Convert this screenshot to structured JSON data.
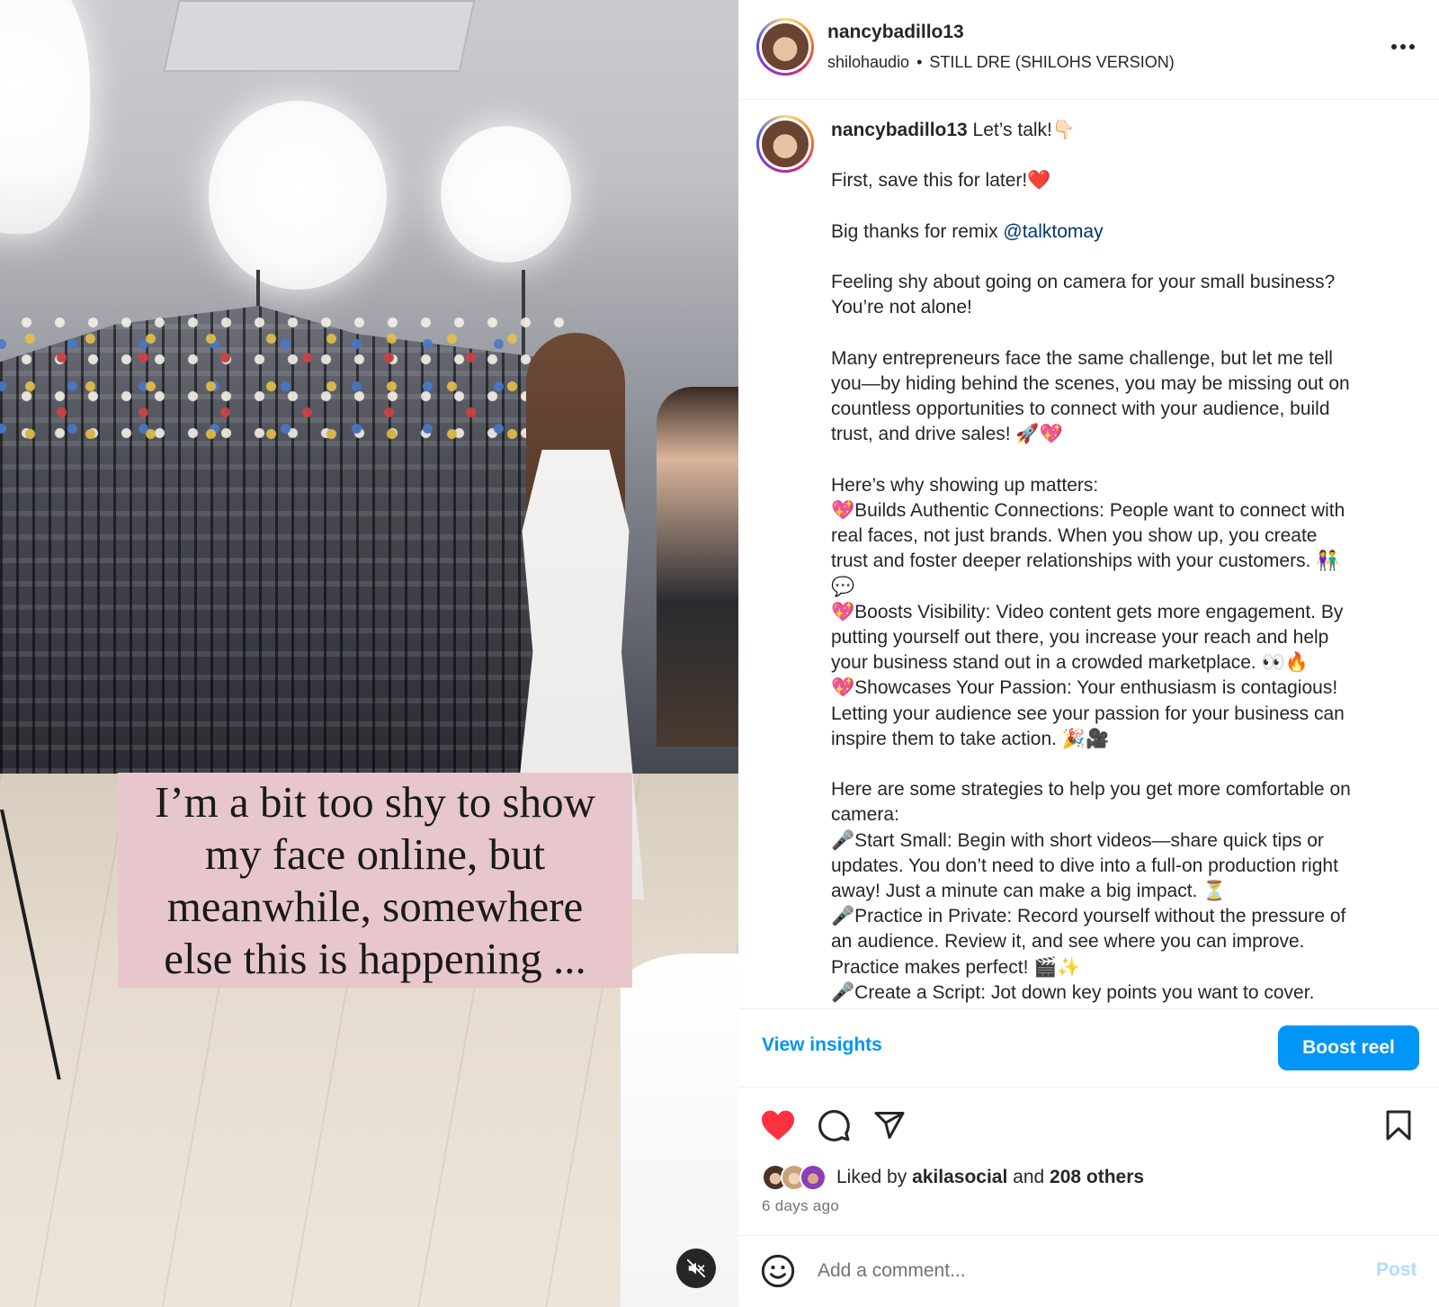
{
  "video": {
    "overlay_text": "I’m a bit too shy to show my face online, but meanwhile, somewhere else this is happening ...",
    "mute_icon": "speaker-muted-icon"
  },
  "header": {
    "username": "nancybadillo13",
    "audio_artist": "shilohaudio",
    "audio_separator": "•",
    "audio_track": "STILL DRE (SHILOHS VERSION)",
    "more_icon": "more-horizontal-icon"
  },
  "caption": {
    "username": "nancybadillo13",
    "opening": " Let’s talk!👇🏻",
    "save_line": "First, save this for later!❤️",
    "thanks_prefix": "Big thanks for remix ",
    "mention": "@talktomay",
    "shy_l1": "Feeling shy about going on camera for your small business?",
    "shy_l2": "You’re not alone!",
    "many_l1": "Many entrepreneurs face the same challenge, but let me tell",
    "many_l2": "you—by hiding behind the scenes, you may be missing out on",
    "many_l3": "countless opportunities to connect with your audience, build",
    "many_l4": "trust, and drive sales! 🚀💖",
    "why_heading": "Here’s why showing up matters:",
    "why_1_l1": "💖Builds Authentic Connections: People want to connect with",
    "why_1_l2": "real faces, not just brands. When you show up, you create",
    "why_1_l3": "trust and foster deeper relationships with your customers. 👫",
    "why_1_l4": "💬",
    "why_2_l1": "💖Boosts Visibility: Video content gets more engagement. By",
    "why_2_l2": "putting yourself out there, you increase your reach and help",
    "why_2_l3": "your business stand out in a crowded marketplace. 👀🔥",
    "why_3_l1": "💖Showcases Your Passion: Your enthusiasm is contagious!",
    "why_3_l2": "Letting your audience see your passion for your business can",
    "why_3_l3": "inspire them to take action. 🎉🎥",
    "strat_l1": "Here are some strategies to help you get more comfortable on",
    "strat_l2": "camera:",
    "strat_1_l1": "🎤Start Small: Begin with short videos—share quick tips or",
    "strat_1_l2": "updates. You don’t need to dive into a full-on production right",
    "strat_1_l3": "away! Just a minute can make a big impact. ⏳",
    "strat_2_l1": "🎤Practice in Private: Record yourself without the pressure of",
    "strat_2_l2": "an audience. Review it, and see where you can improve.",
    "strat_2_l3": "Practice makes perfect! 🎬✨",
    "strat_3_l1": "🎤Create a Script: Jot down key points you want to cover."
  },
  "actions": {
    "view_insights": "View insights",
    "boost_reel": "Boost reel",
    "like_icon": "heart-filled-icon",
    "comment_icon": "comment-icon",
    "share_icon": "send-icon",
    "save_icon": "bookmark-icon",
    "like_color": "#ff3040",
    "accent_color": "#0095f6"
  },
  "likes": {
    "prefix": "Liked by ",
    "first_liker": "akilasocial",
    "middle": " and ",
    "others": "208 others",
    "timestamp": "6 days ago"
  },
  "comment": {
    "emoji_icon": "smiley-face-icon",
    "placeholder": "Add a comment...",
    "post_label": "Post"
  }
}
